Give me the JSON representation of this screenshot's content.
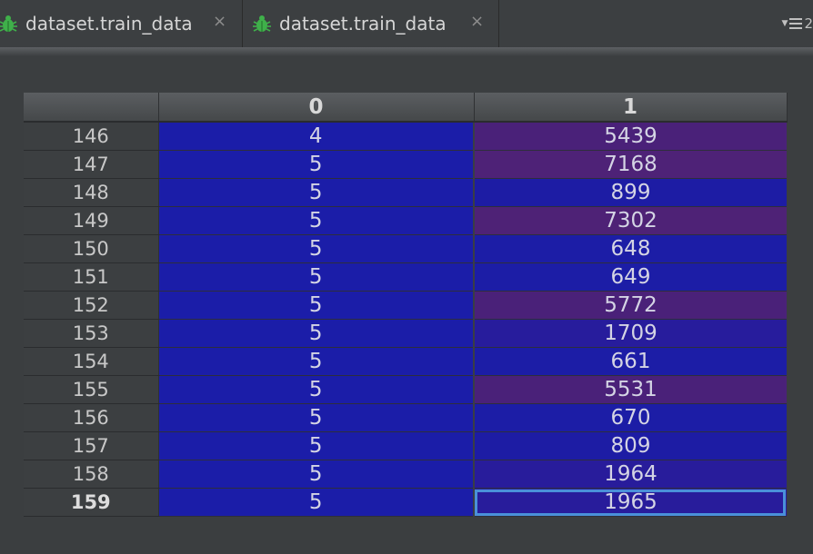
{
  "tabs": [
    {
      "label": "dataset.train_data",
      "close": "×",
      "icon": "bug-icon"
    },
    {
      "label": "dataset.train_data",
      "close": "×",
      "icon": "bug-icon"
    }
  ],
  "tabs_menu": {
    "count": "2"
  },
  "table": {
    "columns": [
      "0",
      "1"
    ],
    "rows": [
      {
        "index": "146",
        "c0": "4",
        "c1": "5439",
        "bg0": "#1b1da8",
        "bg1": "#4a2179"
      },
      {
        "index": "147",
        "c0": "5",
        "c1": "7168",
        "bg0": "#1b1da8",
        "bg1": "#4e2277"
      },
      {
        "index": "148",
        "c0": "5",
        "c1": "899",
        "bg0": "#1b1da8",
        "bg1": "#1d1ca4"
      },
      {
        "index": "149",
        "c0": "5",
        "c1": "7302",
        "bg0": "#1b1da8",
        "bg1": "#4e2276"
      },
      {
        "index": "150",
        "c0": "5",
        "c1": "648",
        "bg0": "#1b1da8",
        "bg1": "#1c1da6"
      },
      {
        "index": "151",
        "c0": "5",
        "c1": "649",
        "bg0": "#1b1da8",
        "bg1": "#1c1da6"
      },
      {
        "index": "152",
        "c0": "5",
        "c1": "5772",
        "bg0": "#1b1da8",
        "bg1": "#4a2179"
      },
      {
        "index": "153",
        "c0": "5",
        "c1": "1709",
        "bg0": "#1b1da8",
        "bg1": "#271c9c"
      },
      {
        "index": "154",
        "c0": "5",
        "c1": "661",
        "bg0": "#1b1da8",
        "bg1": "#1c1da6"
      },
      {
        "index": "155",
        "c0": "5",
        "c1": "5531",
        "bg0": "#1b1da8",
        "bg1": "#4a2179"
      },
      {
        "index": "156",
        "c0": "5",
        "c1": "670",
        "bg0": "#1b1da8",
        "bg1": "#1c1da6"
      },
      {
        "index": "157",
        "c0": "5",
        "c1": "809",
        "bg0": "#1b1da8",
        "bg1": "#1d1ca4"
      },
      {
        "index": "158",
        "c0": "5",
        "c1": "1964",
        "bg0": "#1b1da8",
        "bg1": "#281c9b"
      },
      {
        "index": "159",
        "c0": "5",
        "c1": "1965",
        "bg0": "#1b1da8",
        "bg1": "#281c9b"
      }
    ],
    "current_row": "159",
    "selection_color": "#4a90d9"
  }
}
